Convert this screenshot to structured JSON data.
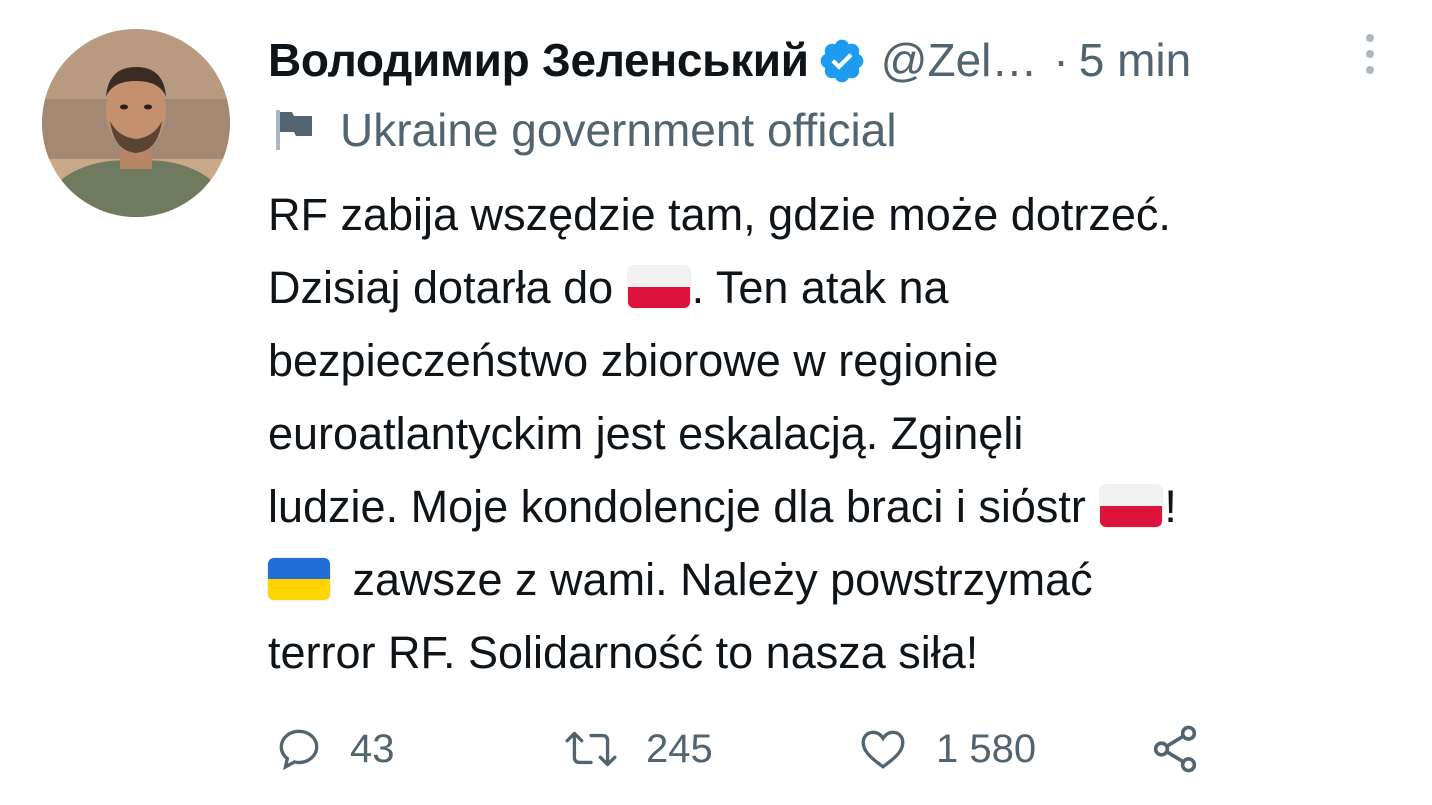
{
  "tweet": {
    "author": {
      "display_name": "Володимир Зеленський",
      "handle": "@Zel…",
      "verified": true
    },
    "separator": "·",
    "time": "5 min",
    "label": "Ukraine government official",
    "body_lines": [
      "RF zabija wszędzie tam, gdzie może dotrzeć.",
      [
        "Dzisiaj dotarła do ",
        ". Ten atak na"
      ],
      "bezpieczeństwo zbiorowe w regionie",
      "euroatlantyckim jest eskalacją.  Zginęli",
      [
        "ludzie. Moje kondolencje dla braci i siόstr ",
        "!"
      ],
      " zawsze z wami. Należy powstrzymać",
      "terror RF.  Solidarność to nasza siła!"
    ],
    "flags": {
      "poland": "flag-poland",
      "ukraine": "flag-ukraine"
    },
    "actions": {
      "replies": "43",
      "retweets": "245",
      "likes": "1 580"
    },
    "colors": {
      "text": "#0f1419",
      "secondary": "#536471",
      "verified": "#1d9bf0"
    },
    "icons": {
      "verified": "verified-badge-icon",
      "more": "more-vertical-icon",
      "label": "flag-icon",
      "reply": "reply-icon",
      "retweet": "retweet-icon",
      "like": "heart-icon",
      "share": "share-icon"
    }
  }
}
